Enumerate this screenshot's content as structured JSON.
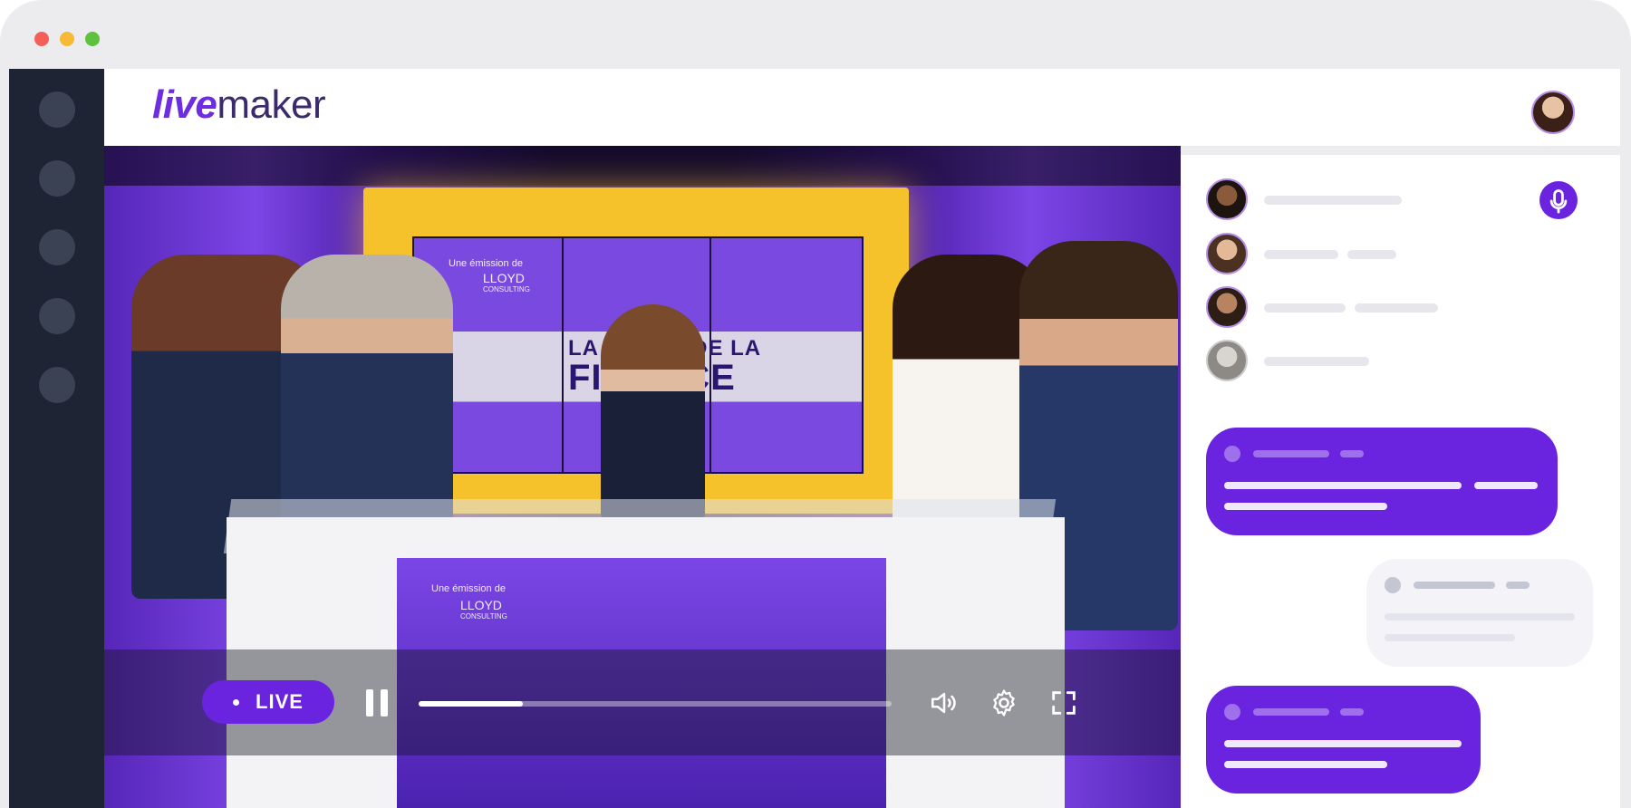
{
  "window": {
    "traffic_lights": [
      "close",
      "minimize",
      "zoom"
    ]
  },
  "brand": {
    "logo_live": "live",
    "logo_maker": "maker"
  },
  "rail": {
    "items": [
      "nav-1",
      "nav-2",
      "nav-3",
      "nav-4",
      "nav-5"
    ]
  },
  "video": {
    "set_text": {
      "tagline": "Une émission de",
      "sponsor": "LLOYD",
      "sponsor_sub": "CONSULTING",
      "show_line1": "LA REVUE DE LA",
      "show_line2": "FINANCE"
    },
    "controls": {
      "live_label": "LIVE",
      "progress": 0.22,
      "icons": [
        "pause-icon",
        "volume-icon",
        "settings-icon",
        "fullscreen-icon"
      ]
    }
  },
  "colors": {
    "accent": "#6a24e0",
    "rail": "#1e2433",
    "chrome": "#ececef"
  }
}
